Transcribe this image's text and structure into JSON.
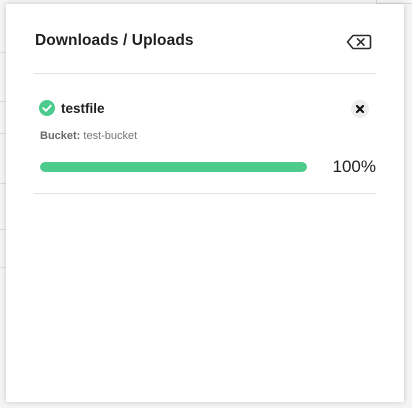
{
  "panel": {
    "title": "Downloads / Uploads",
    "clear_icon": "backspace-clear-icon"
  },
  "items": [
    {
      "name": "testfile",
      "status": "complete",
      "status_icon": "check-circle-icon",
      "bucket_label": "Bucket:",
      "bucket_value": "test-bucket",
      "progress": 1.0,
      "progress_text": "100%",
      "remove_icon": "close-icon"
    }
  ],
  "colors": {
    "accent_green": "#4ccb8c",
    "panel_bg": "#ffffff"
  }
}
